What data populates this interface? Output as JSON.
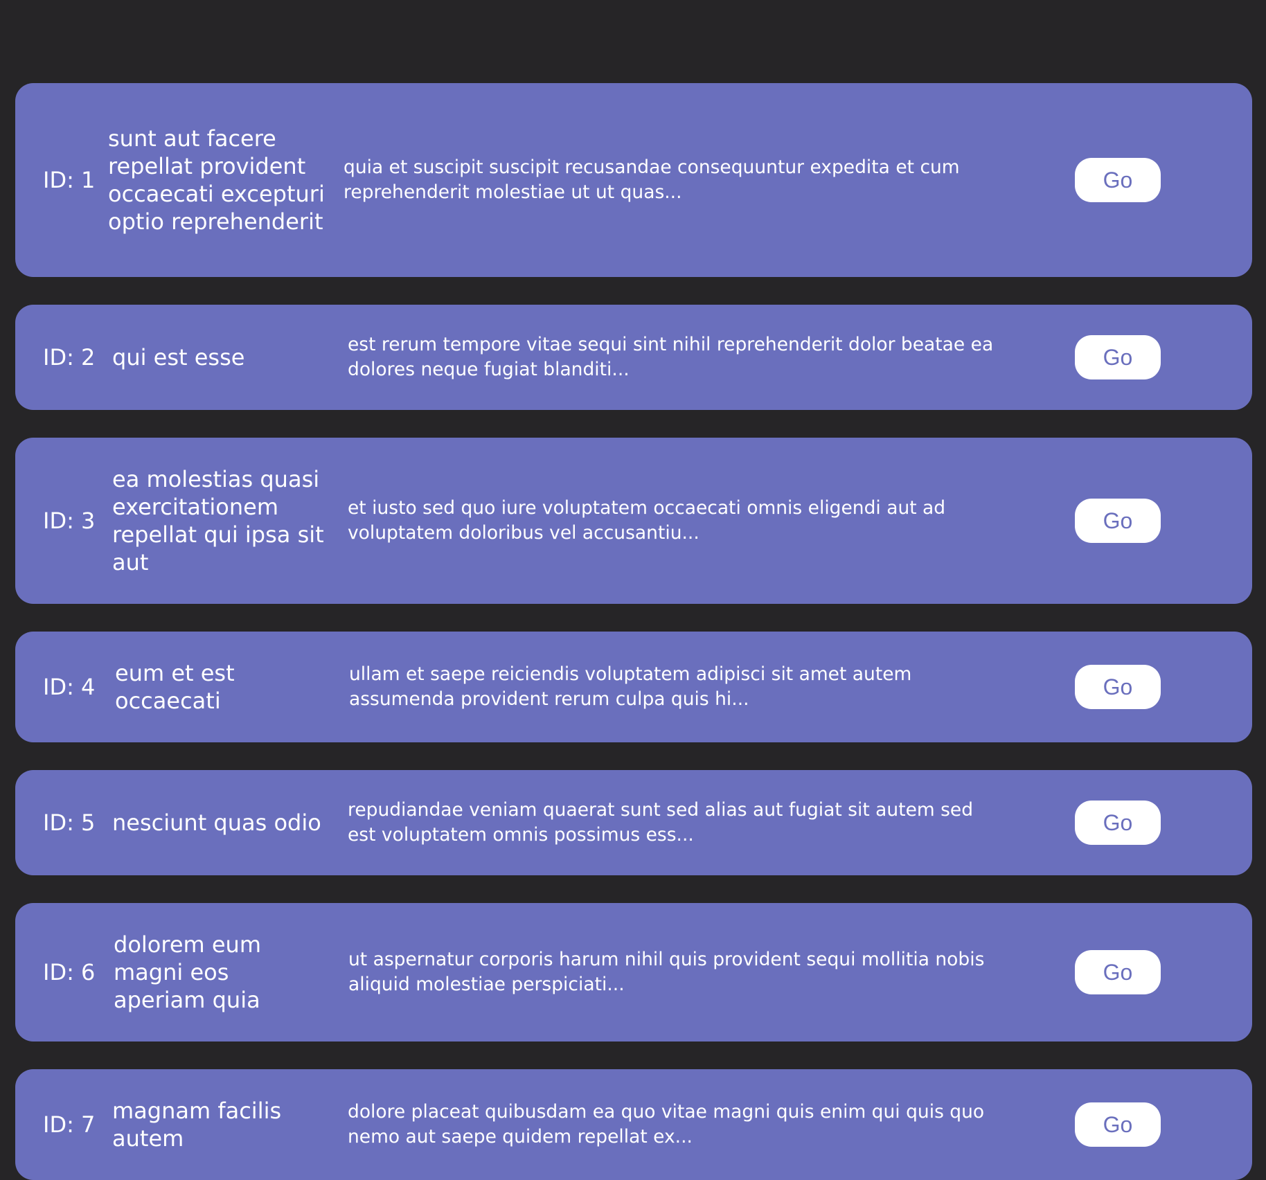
{
  "items": [
    {
      "id_label": "ID: 1",
      "title": "sunt aut facere repellat provident occaecati excepturi optio reprehenderit",
      "body": "quia et suscipit suscipit recusandae consequuntur expedita et cum reprehenderit molestiae ut ut quas...",
      "button_label": "Go"
    },
    {
      "id_label": "ID: 2",
      "title": "qui est esse",
      "body": "est rerum tempore vitae sequi sint nihil reprehenderit dolor beatae ea dolores neque fugiat blanditi...",
      "button_label": "Go"
    },
    {
      "id_label": "ID: 3",
      "title": "ea molestias quasi exercitationem repellat qui ipsa sit aut",
      "body": "et iusto sed quo iure voluptatem occaecati omnis eligendi aut ad voluptatem doloribus vel accusantiu...",
      "button_label": "Go"
    },
    {
      "id_label": "ID: 4",
      "title": "eum et est occaecati",
      "body": "ullam et saepe reiciendis voluptatem adipisci sit amet autem assumenda provident rerum culpa quis hi...",
      "button_label": "Go"
    },
    {
      "id_label": "ID: 5",
      "title": "nesciunt quas odio",
      "body": "repudiandae veniam quaerat sunt sed alias aut fugiat sit autem sed est voluptatem omnis possimus ess...",
      "button_label": "Go"
    },
    {
      "id_label": "ID: 6",
      "title": "dolorem eum magni eos aperiam quia",
      "body": "ut aspernatur corporis harum nihil quis provident sequi mollitia nobis aliquid molestiae perspiciati...",
      "button_label": "Go"
    },
    {
      "id_label": "ID: 7",
      "title": "magnam facilis autem",
      "body": "dolore placeat quibusdam ea quo vitae magni quis enim qui quis quo nemo aut saepe quidem repellat ex...",
      "button_label": "Go"
    }
  ],
  "colors": {
    "page_background": "#262527",
    "card_background": "#6a6fbd",
    "text": "#ffffff",
    "button_background": "#ffffff",
    "button_text": "#6a6fbd"
  }
}
